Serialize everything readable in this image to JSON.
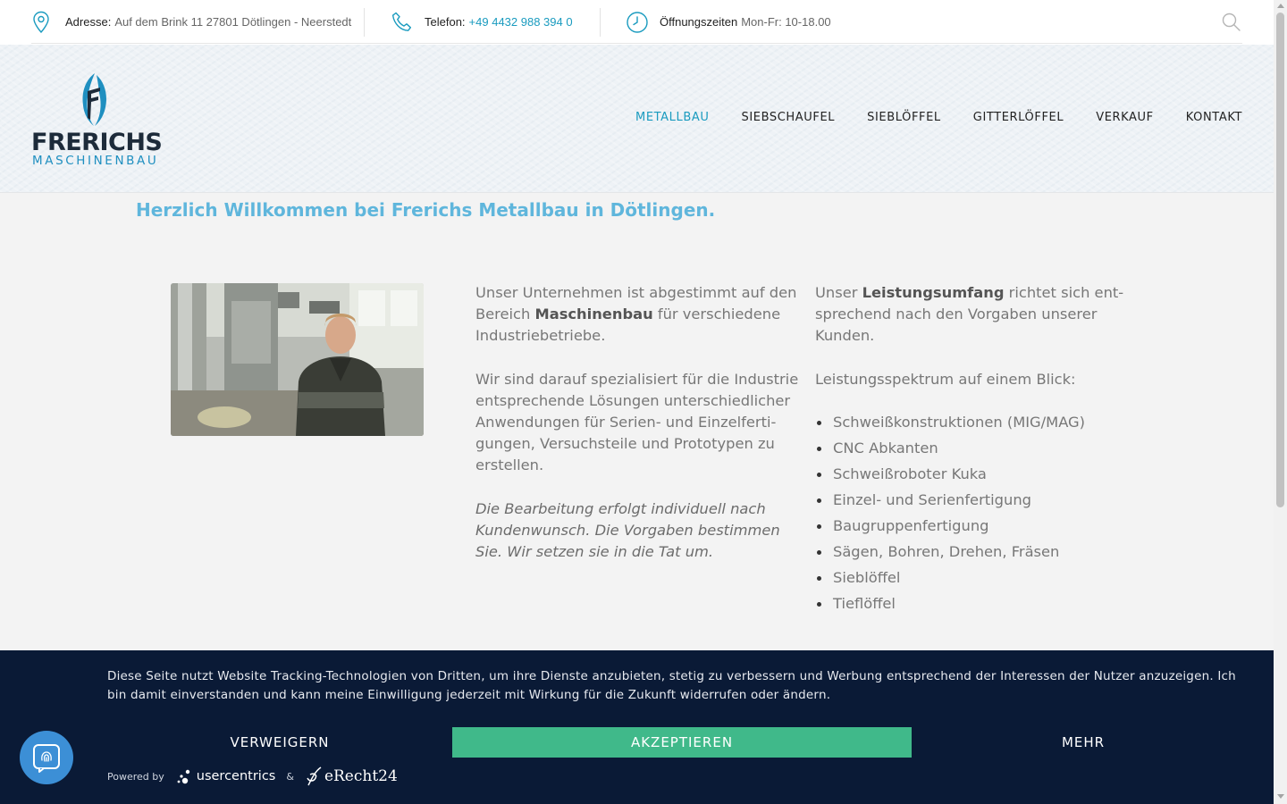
{
  "topbar": {
    "address_label": "Adresse:",
    "address_value": "Auf dem Brink 11 27801 Dötlingen - Neerstedt",
    "phone_label": "Telefon:",
    "phone_value": "+49 4432 988 394 0",
    "hours_label": "Öffnungszeiten",
    "hours_value": "Mon-Fr: 10-18.00",
    "icons": [
      "location-pin-icon",
      "phone-icon",
      "clock-icon",
      "search-icon"
    ],
    "accent": "#1a9bbf"
  },
  "logo": {
    "main": "FRERICHS",
    "sub": "MASCHINENBAU"
  },
  "nav": {
    "items": [
      {
        "label": "METALLBAU",
        "active": true
      },
      {
        "label": "SIEBSCHAUFEL"
      },
      {
        "label": "SIEBLÖFFEL"
      },
      {
        "label": "GITTERLÖFFEL"
      },
      {
        "label": "VERKAUF"
      },
      {
        "label": "KONTAKT"
      }
    ]
  },
  "main": {
    "welcome": "Herzlich Willkommen bei Frerichs Metallbau in Dötlingen.",
    "col1": {
      "p1_a": "Unser Unternehmen ist abgestimmt auf den Bereich ",
      "p1_bold": "Maschinenbau",
      "p1_b": " für verschiedene Industriebetriebe.",
      "p2": "Wir sind darauf spezialisiert für die Industrie entsprechende Lösungen unterschiedlicher Anwendungen für Serien- und Einzelferti-gungen, Versuchsteile und Prototypen zu erstellen.",
      "p3": "Die Bearbeitung erfolgt individuell nach Kundenwunsch. Die Vorgaben bestimmen Sie. Wir setzen sie in die Tat um."
    },
    "col2": {
      "p1_a": "Unser ",
      "p1_bold": "Leistungsumfang",
      "p1_b": " richtet sich ent-sprechend nach den Vorgaben unserer Kunden.",
      "p2": "Leistungsspektrum auf einem Blick:",
      "services": [
        "Schweißkonstruktionen (MIG/MAG)",
        "CNC Abkanten",
        "Schweißroboter Kuka",
        "Einzel- und Serienfertigung",
        "Baugruppenfertigung",
        "Sägen, Bohren, Drehen, Fräsen",
        "Sieblöffel",
        "Tieflöffel"
      ]
    }
  },
  "cookie": {
    "text": "Diese Seite nutzt Website Tracking-Technologien von Dritten, um ihre Dienste anzubieten, stetig zu verbessern und Werbung entsprechend der Interessen der Nutzer anzuzeigen. Ich bin damit einverstanden und kann meine Einwilligung jederzeit mit Wirkung für die Zukunft widerrufen oder ändern.",
    "deny": "VERWEIGERN",
    "accept": "AKZEPTIEREN",
    "more": "MEHR",
    "powered_by": "Powered by",
    "brand1": "usercentrics",
    "amp": "&",
    "brand2": "eRecht24",
    "accept_color": "#40b98a",
    "background": "#0a1a36"
  },
  "privacy_button": {
    "icon": "fingerprint-icon"
  }
}
